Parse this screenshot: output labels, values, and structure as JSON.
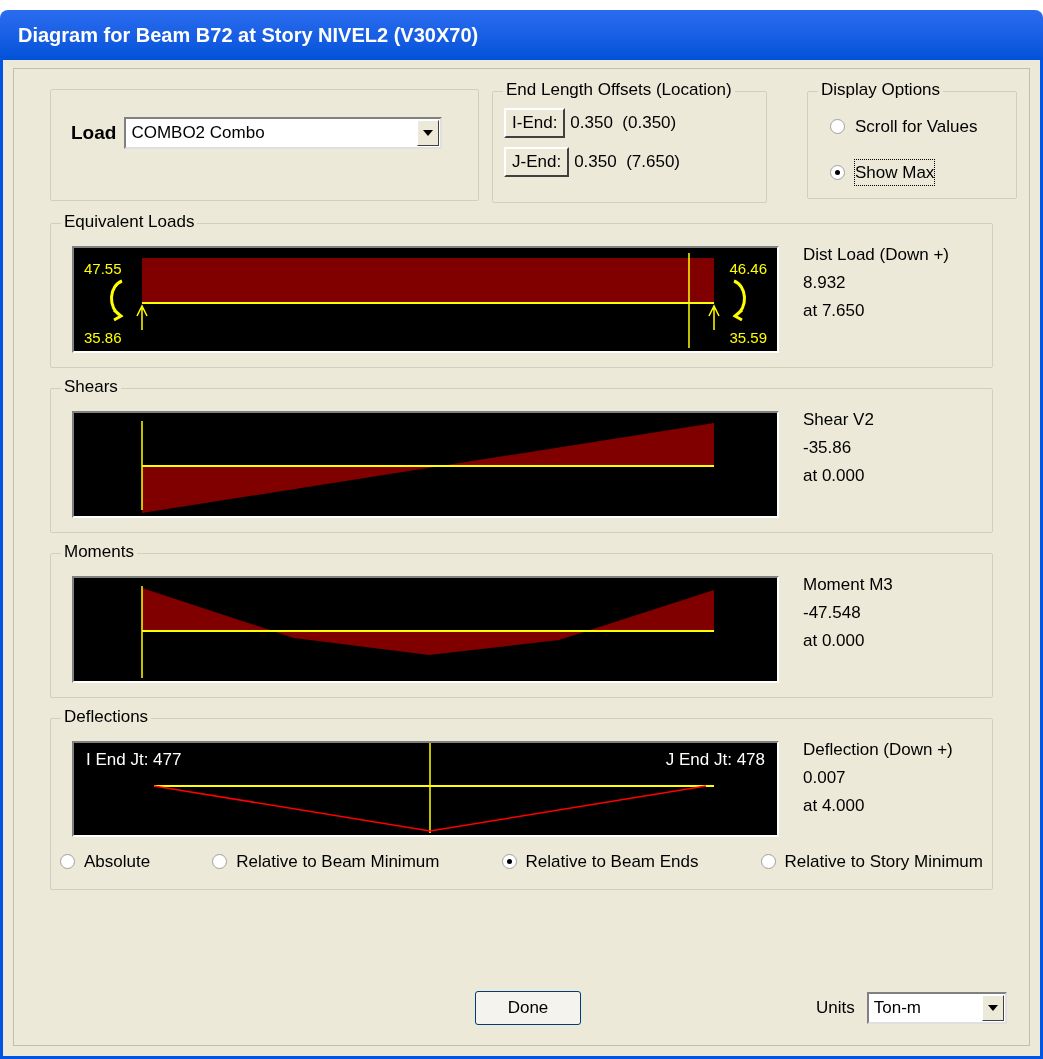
{
  "window": {
    "title": "Diagram for Beam B72 at Story NIVEL2 (V30X70)"
  },
  "load": {
    "label": "Load",
    "value": "COMBO2 Combo"
  },
  "end_offsets": {
    "title": "End Length Offsets (Location)",
    "rows": [
      {
        "button": "I-End:",
        "value": "0.350  (0.350)"
      },
      {
        "button": "J-End:",
        "value": "0.350  (7.650)"
      }
    ]
  },
  "display_options": {
    "title": "Display Options",
    "options": [
      {
        "label": "Scroll for Values",
        "selected": false,
        "focused": false
      },
      {
        "label": "Show Max",
        "selected": true,
        "focused": true
      }
    ]
  },
  "panels": [
    {
      "kind": "loads",
      "title": "Equivalent Loads",
      "labels": [
        "47.55",
        "35.86",
        "46.46",
        "35.59"
      ],
      "readout": [
        "Dist Load (Down +)",
        "8.932",
        "at 7.650"
      ]
    },
    {
      "kind": "shear",
      "title": "Shears",
      "readout": [
        "Shear V2",
        "-35.86",
        "at 0.000"
      ]
    },
    {
      "kind": "moment",
      "title": "Moments",
      "readout": [
        "Moment M3",
        "-47.548",
        "at 0.000"
      ]
    },
    {
      "kind": "deflection",
      "title": "Deflections",
      "labels": [
        "I End Jt: 477",
        "J End Jt: 478"
      ],
      "readout": [
        "Deflection (Down +)",
        "0.007",
        "at 4.000"
      ],
      "options": [
        {
          "label": "Absolute",
          "selected": false
        },
        {
          "label": "Relative to Beam Minimum",
          "selected": false
        },
        {
          "label": "Relative to Beam Ends",
          "selected": true
        },
        {
          "label": "Relative to Story Minimum",
          "selected": false
        }
      ]
    }
  ],
  "done": "Done",
  "units": {
    "label": "Units",
    "value": "Ton-m"
  }
}
